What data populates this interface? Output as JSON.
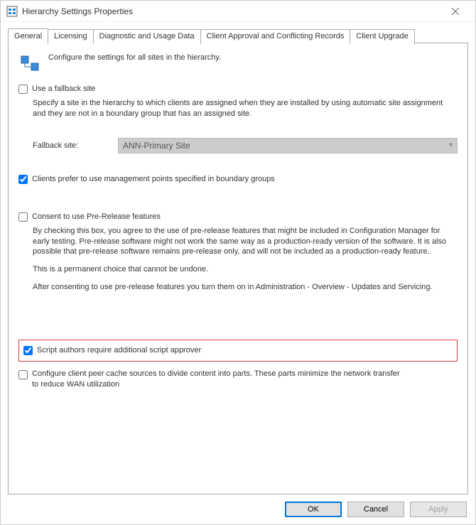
{
  "window": {
    "title": "Hierarchy Settings Properties"
  },
  "tabs": {
    "t0": "General",
    "t1": "Licensing",
    "t2": "Diagnostic and Usage Data",
    "t3": "Client Approval and Conflicting Records",
    "t4": "Client Upgrade"
  },
  "general": {
    "intro": "Configure the settings for all sites in the hierarchy.",
    "fallback_checkbox": "Use a fallback site",
    "fallback_help": "Specify a site in the hierarchy to which clients are assigned when they are installed by using automatic site assignment and they are not in a boundary group that has an assigned site.",
    "fallback_label": "Fallback site:",
    "fallback_value": "ANN-Primary Site",
    "mp_checkbox": "Clients prefer to use management points specified in boundary groups",
    "prerelease_checkbox": "Consent to use Pre-Release features",
    "prerelease_p1": "By checking this box, you agree to the use of pre-release features that might be included in Configuration Manager for early testing. Pre-release software might not work the same way as a production-ready version of the software. It is also possible that pre-release software remains pre-release only, and will not be included as a production-ready feature.",
    "prerelease_p2": "This is a permanent choice that cannot be undone.",
    "prerelease_p3": "After consenting to use pre-release features you turn them on in Administration - Overview - Updates and Servicing.",
    "script_checkbox": "Script authors require additional script approver",
    "peercache_checkbox": "Configure client peer cache sources to divide content into parts. These parts minimize the network transfer to reduce WAN utilization"
  },
  "buttons": {
    "ok": "OK",
    "cancel": "Cancel",
    "apply": "Apply"
  }
}
